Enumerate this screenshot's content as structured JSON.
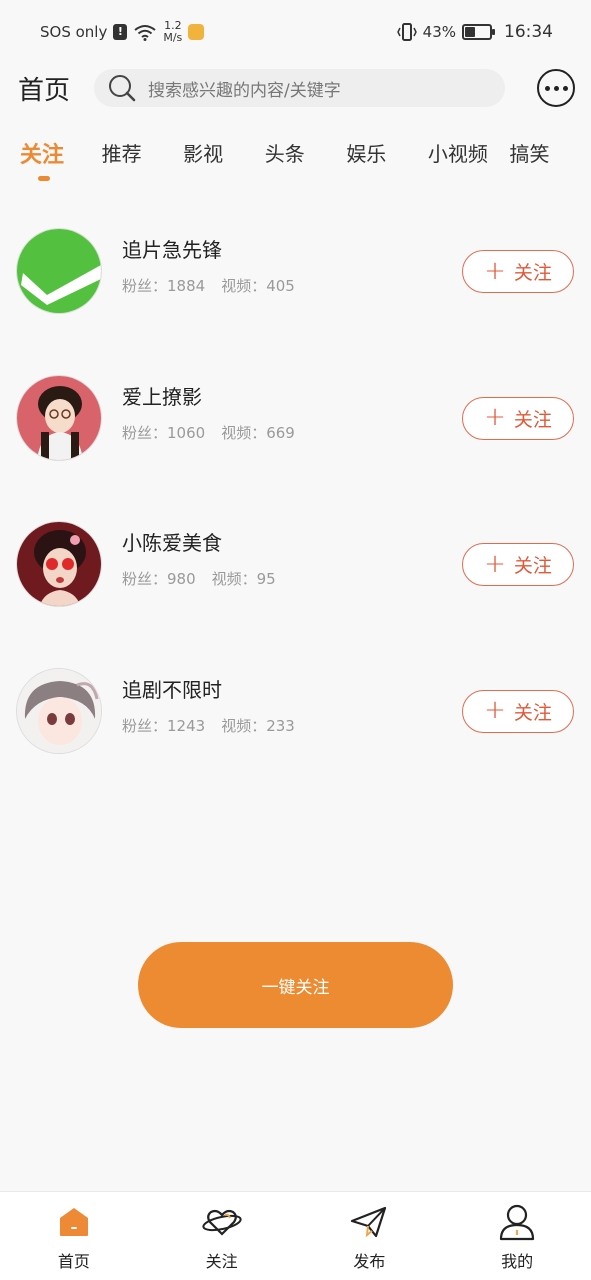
{
  "status_bar": {
    "carrier": "SOS only",
    "net_speed_value": "1.2",
    "net_speed_unit": "M/s",
    "battery": "43%",
    "battery_level": 0.43,
    "time": "16:34"
  },
  "header": {
    "title": "首页",
    "search_placeholder": "搜索感兴趣的内容/关键字"
  },
  "tabs": [
    {
      "label": "关注",
      "active": true
    },
    {
      "label": "推荐"
    },
    {
      "label": "影视"
    },
    {
      "label": "头条"
    },
    {
      "label": "娱乐"
    },
    {
      "label": "小视频"
    },
    {
      "label": "搞笑"
    }
  ],
  "creators": [
    {
      "name": "追片急先锋",
      "fans": "粉丝：1884",
      "videos": "视频：405",
      "follow_label": "关注"
    },
    {
      "name": "爱上撩影",
      "fans": "粉丝：1060",
      "videos": "视频：669",
      "follow_label": "关注"
    },
    {
      "name": "小陈爱美食",
      "fans": "粉丝：980",
      "videos": "视频：95",
      "follow_label": "关注"
    },
    {
      "name": "追剧不限时",
      "fans": "粉丝：1243",
      "videos": "视频：233",
      "follow_label": "关注"
    }
  ],
  "one_key_follow": "一键关注",
  "bottom_nav": [
    {
      "label": "首页",
      "icon": "home-icon",
      "active": true
    },
    {
      "label": "关注",
      "icon": "heart-planet-icon"
    },
    {
      "label": "发布",
      "icon": "paper-plane-icon"
    },
    {
      "label": "我的",
      "icon": "user-icon"
    }
  ],
  "colors": {
    "accent": "#ec8a33",
    "follow_border": "#e06c50"
  }
}
